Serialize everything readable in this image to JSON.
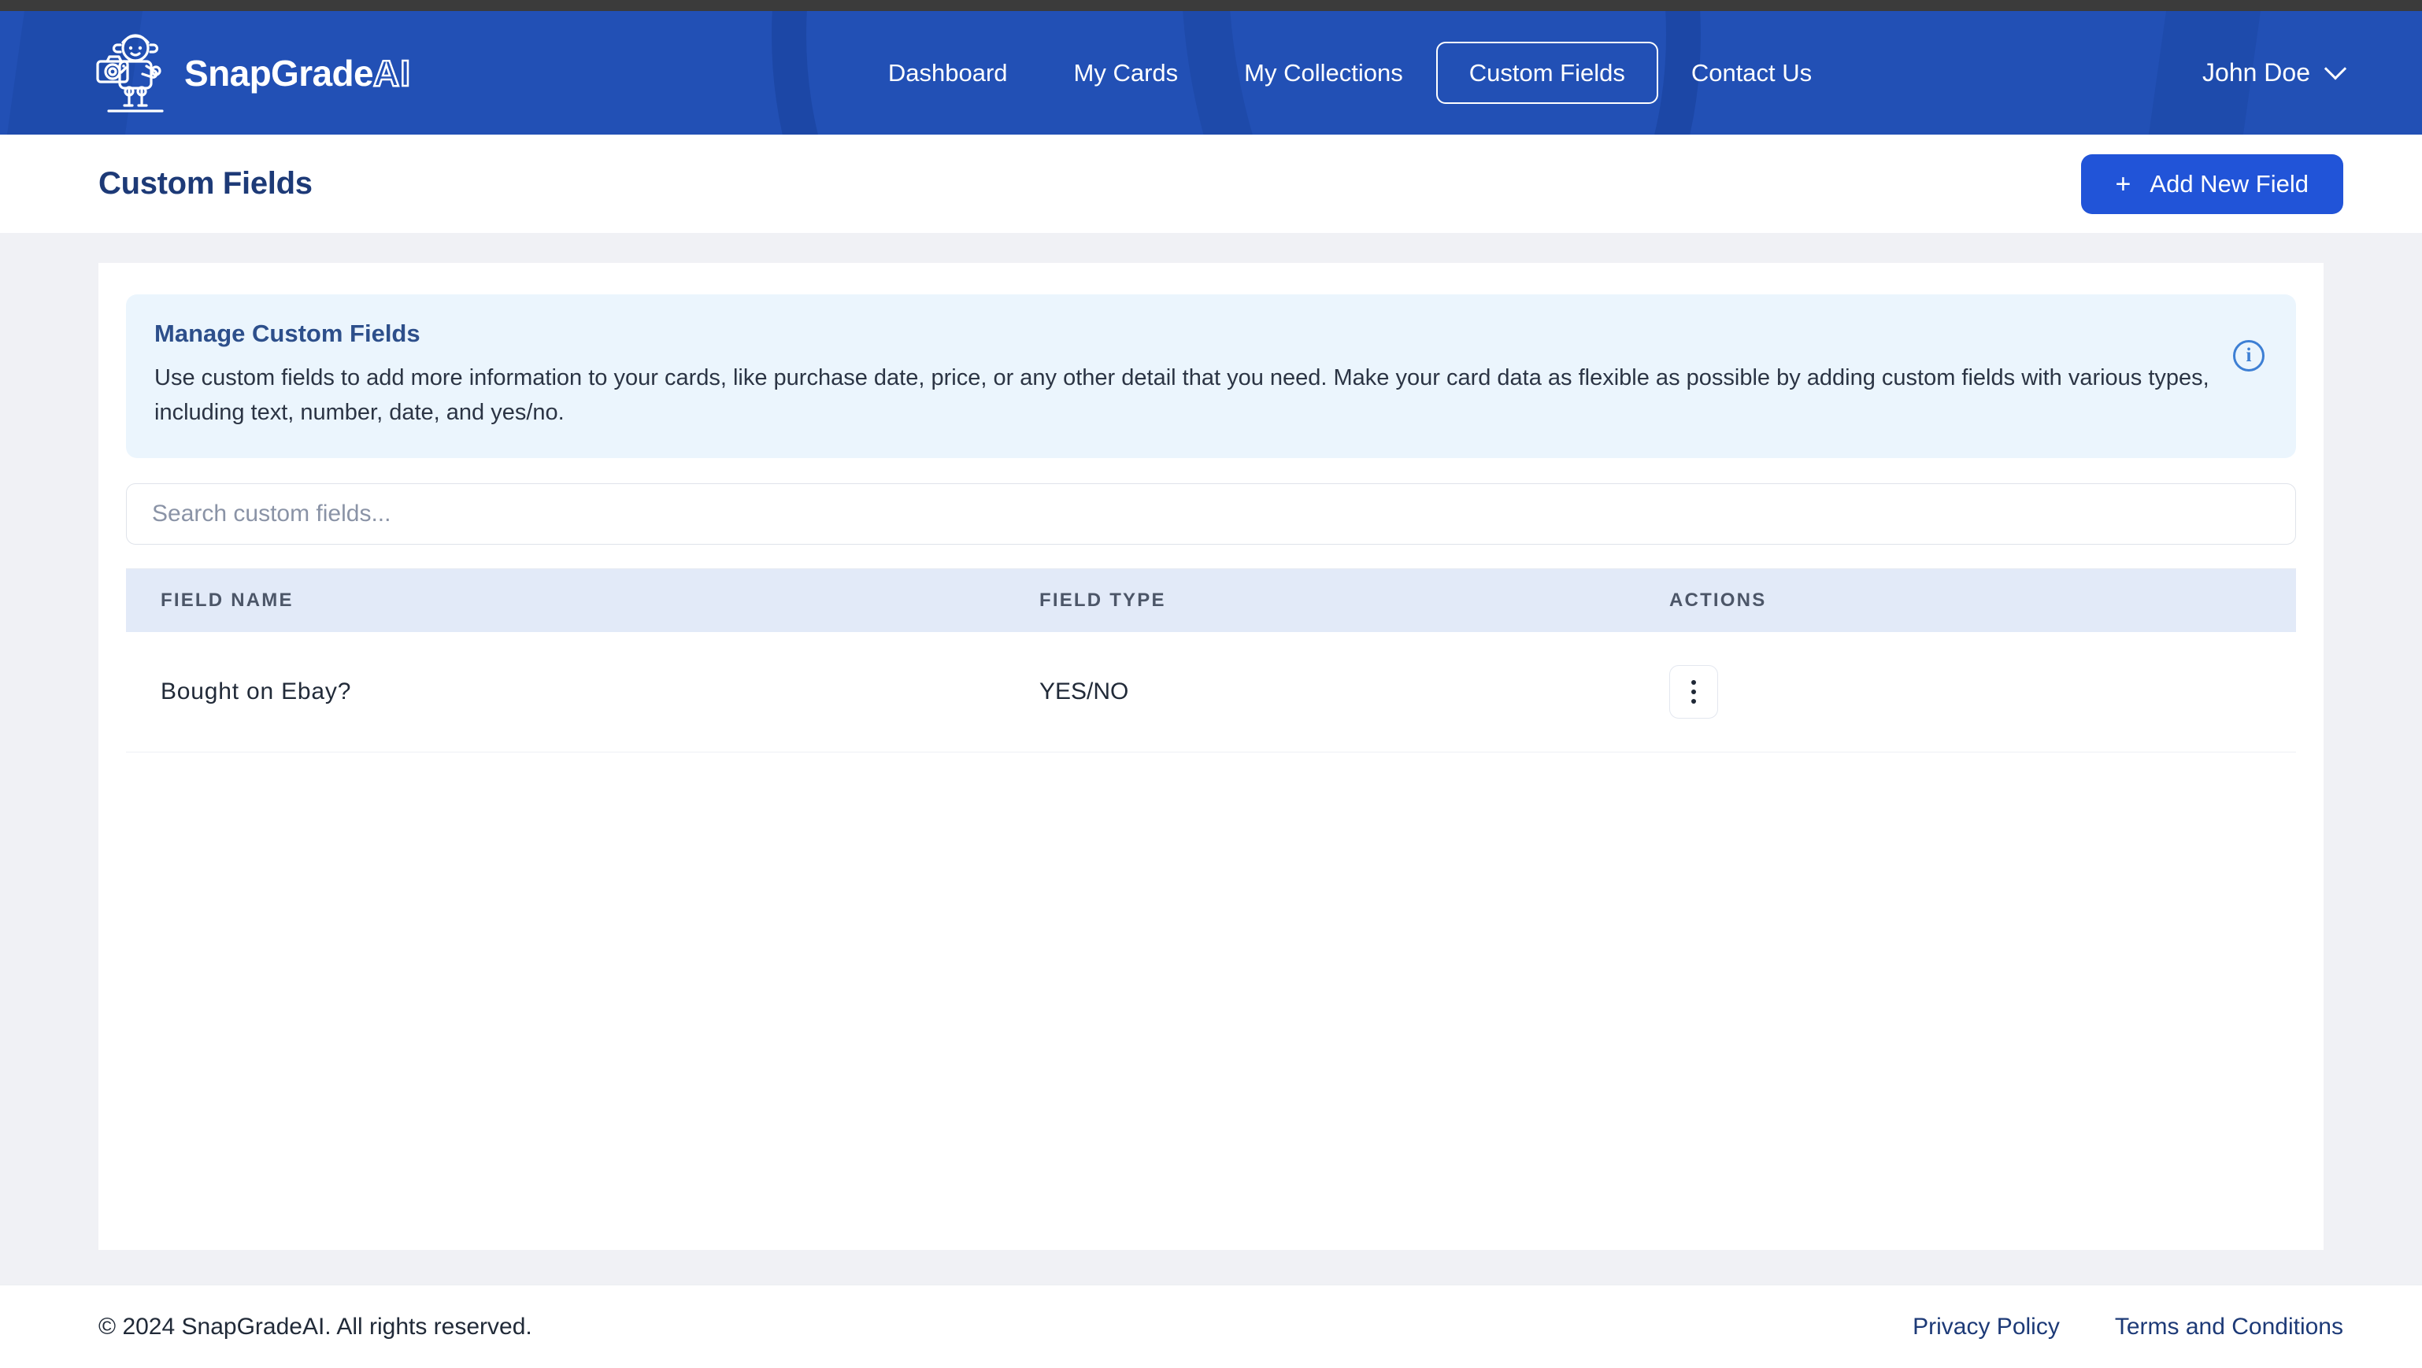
{
  "brand": {
    "name_main": "SnapGrade",
    "name_accent": "AI",
    "logo_icon": "robot-camera-logo"
  },
  "nav": {
    "items": [
      {
        "label": "Dashboard",
        "active": false
      },
      {
        "label": "My Cards",
        "active": false
      },
      {
        "label": "My Collections",
        "active": false
      },
      {
        "label": "Custom Fields",
        "active": true
      },
      {
        "label": "Contact Us",
        "active": false
      }
    ],
    "user": {
      "name": "John Doe",
      "caret_icon": "chevron-down-icon"
    }
  },
  "titlebar": {
    "title": "Custom Fields",
    "add_button": {
      "plus": "+",
      "label": "Add New Field"
    }
  },
  "banner": {
    "title": "Manage Custom Fields",
    "body": "Use custom fields to add more information to your cards, like purchase date, price, or any other detail that you need. Make your card data as flexible as possible by adding custom fields with various types, including text, number, date, and yes/no.",
    "info_icon": "info-circle-icon",
    "info_glyph": "i"
  },
  "search": {
    "value": "",
    "placeholder": "Search custom fields..."
  },
  "table": {
    "columns": [
      "FIELD NAME",
      "FIELD TYPE",
      "ACTIONS"
    ],
    "rows": [
      {
        "field_name": "Bought  on  Ebay?",
        "field_type": "YES/NO",
        "actions_icon": "kebab-menu-icon"
      }
    ]
  },
  "footer": {
    "copyright": "© 2024 SnapGradeAI. All rights reserved.",
    "links": [
      "Privacy Policy",
      "Terms and Conditions"
    ]
  },
  "colors": {
    "header_blue": "#2250b5",
    "primary_blue": "#2154d8",
    "navy_text": "#1d3a77",
    "banner_bg": "#ebf5fd",
    "table_header_bg": "#e2eaf8",
    "page_bg": "#f0f1f5"
  }
}
